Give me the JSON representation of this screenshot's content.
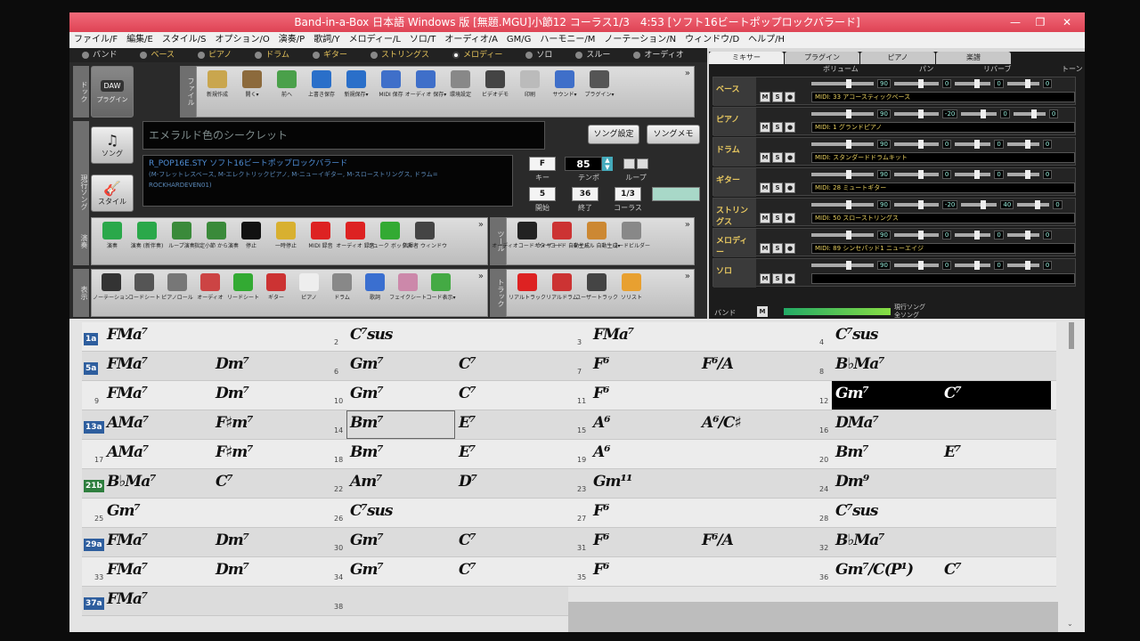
{
  "window": {
    "title": "Band-in-a-Box 日本語 Windows 版 [無題.MGU]小節12 コーラス1/3　4:53 [ソフト16ビートポップロックバラード]",
    "min": "—",
    "max": "❐",
    "close": "✕"
  },
  "menu": [
    "ファイル/F",
    "編集/E",
    "スタイル/S",
    "オプション/O",
    "演奏/P",
    "歌詞/Y",
    "メロディー/L",
    "ソロ/T",
    "オーディオ/A",
    "GM/G",
    "ハーモニー/M",
    "ノーテーション/N",
    "ウィンドウ/D",
    "ヘルプ/H"
  ],
  "tracks": [
    {
      "label": "バンド",
      "color": "normal"
    },
    {
      "label": "ベース",
      "color": "gold"
    },
    {
      "label": "ピアノ",
      "color": "gold"
    },
    {
      "label": "ドラム",
      "color": "gold"
    },
    {
      "label": "ギター",
      "color": "gold"
    },
    {
      "label": "ストリングス",
      "color": "gold"
    },
    {
      "label": "メロディー",
      "color": "gold",
      "active": true
    },
    {
      "label": "ソロ",
      "color": "normal"
    },
    {
      "label": "スルー",
      "color": "normal"
    },
    {
      "label": "オーディオ",
      "color": "normal"
    }
  ],
  "side_labels": {
    "dock": "ドック",
    "file": "ファイル",
    "play": "演奏",
    "view": "表示",
    "tool": "ツール",
    "track": "トラック",
    "current_song": "現行ソング"
  },
  "top_toolbar": [
    {
      "label": "新規作成",
      "icon": "folder-icon"
    },
    {
      "label": "開く▾",
      "icon": "open-icon"
    },
    {
      "label": "前へ",
      "icon": "prev-icon"
    },
    {
      "label": "上書き保存",
      "icon": "save-icon"
    },
    {
      "label": "新規保存▾",
      "icon": "saveas-icon"
    },
    {
      "label": "MIDI 保存",
      "icon": "midi-save-icon"
    },
    {
      "label": "オーディオ 保存▾",
      "icon": "audio-save-icon"
    },
    {
      "label": "環境設定",
      "icon": "prefs-icon"
    },
    {
      "label": "ビデオデモ",
      "icon": "video-icon"
    },
    {
      "label": "印刷",
      "icon": "print-icon"
    },
    {
      "label": "サウンド▾",
      "icon": "sound-icon"
    },
    {
      "label": "プラグイン▾",
      "icon": "plugin-icon"
    }
  ],
  "dock_buttons": {
    "daw": "DAW",
    "plugin": "プラグイン"
  },
  "song_button": "ソング",
  "style_button": "スタイル",
  "song_title": "エメラルド色のシークレット",
  "style_text": "R_POP16E.STY ソフト16ビートポップロックバラード",
  "style_sub1": "(M-フレットレスベース, M-エレクトリックピアノ, M-ニューイギター, M-スローストリングス, ドラム=",
  "style_sub2": "ROCKHARDEVEN01)",
  "song_settings": "ソング設定",
  "song_memo": "ソングメモ",
  "key": {
    "value": "F",
    "label": "キー"
  },
  "tempo": {
    "value": "85",
    "label": "テンポ"
  },
  "loop_label": "ループ",
  "start": {
    "value": "5",
    "label": "開始"
  },
  "end": {
    "value": "36",
    "label": "終了"
  },
  "chorus": {
    "value": "1/3",
    "label": "コーラス"
  },
  "play_toolbar": [
    {
      "label": "演奏",
      "icon": "play-icon"
    },
    {
      "label": "演奏 (新伴奏)",
      "icon": "replay-icon"
    },
    {
      "label": "ループ演奏",
      "icon": "loop-icon"
    },
    {
      "label": "指定小節 から演奏",
      "icon": "from-bar-icon"
    },
    {
      "label": "停止",
      "icon": "stop-icon"
    },
    {
      "label": "一時停止",
      "icon": "pause-icon"
    },
    {
      "label": "MIDI 録音",
      "icon": "record-icon"
    },
    {
      "label": "オーディオ 録音",
      "icon": "audio-record-icon"
    },
    {
      "label": "ジューク ボックス",
      "icon": "jukebox-icon"
    },
    {
      "label": "指揮者 ウィンドウ",
      "icon": "conductor-icon"
    }
  ],
  "tool_toolbar": [
    {
      "label": "オーディオコード ウィザード",
      "icon": "chord-wizard-icon"
    },
    {
      "label": "ギターコード 自動生成",
      "icon": "guitar-chord-icon"
    },
    {
      "label": "タイトル 自動生成▾",
      "icon": "title-icon"
    },
    {
      "label": "コードビルダー",
      "icon": "chord-builder-icon"
    }
  ],
  "view_toolbar": [
    {
      "label": "ノーテーション",
      "icon": "notation-icon"
    },
    {
      "label": "コードシート",
      "icon": "chordsheet-icon"
    },
    {
      "label": "ピアノロール",
      "icon": "pianoroll-icon"
    },
    {
      "label": "オーディオ",
      "icon": "audio-edit-icon"
    },
    {
      "label": "リードシート",
      "icon": "leadsheet-icon"
    },
    {
      "label": "ギター",
      "icon": "guitar-icon"
    },
    {
      "label": "ピアノ",
      "icon": "piano-icon"
    },
    {
      "label": "ドラム",
      "icon": "drum-icon"
    },
    {
      "label": "歌詞",
      "icon": "lyrics-icon"
    },
    {
      "label": "フェイクシート",
      "icon": "fakesheet-icon"
    },
    {
      "label": "コード表示▾",
      "icon": "chord-display-icon"
    }
  ],
  "track_toolbar": [
    {
      "label": "リアルトラック",
      "icon": "realtracks-icon"
    },
    {
      "label": "リアルドラム",
      "icon": "realdrums-icon"
    },
    {
      "label": "ユーザートラック",
      "icon": "usertracks-icon"
    },
    {
      "label": "ソリスト",
      "icon": "soloist-icon"
    }
  ],
  "mixer": {
    "tabs": [
      "ミキサー",
      "プラグイン",
      "ピアノ",
      "楽譜"
    ],
    "headers": [
      "ボリューム",
      "パン",
      "リバーブ",
      "トーン"
    ],
    "channels": [
      {
        "name": "ベース",
        "vol": "90",
        "pan": "0",
        "rev": "0",
        "tone": "0",
        "inst": "MIDI: 33 アコースティックベース"
      },
      {
        "name": "ピアノ",
        "vol": "90",
        "pan": "-20",
        "rev": "0",
        "tone": "0",
        "inst": "MIDI: 1 グランドピアノ"
      },
      {
        "name": "ドラム",
        "vol": "90",
        "pan": "0",
        "rev": "0",
        "tone": "0",
        "inst": "MIDI: スタンダードドラムキット"
      },
      {
        "name": "ギター",
        "vol": "90",
        "pan": "0",
        "rev": "0",
        "tone": "0",
        "inst": "MIDI: 28 ミュートギター"
      },
      {
        "name": "ストリングス",
        "vol": "90",
        "pan": "-20",
        "rev": "40",
        "tone": "0",
        "inst": "MIDI: 50 スローストリングス"
      },
      {
        "name": "メロディー",
        "vol": "90",
        "pan": "0",
        "rev": "0",
        "tone": "0",
        "inst": "MIDI: 89 シンセパッド1 ニューエイジ"
      },
      {
        "name": "ソロ",
        "vol": "90",
        "pan": "0",
        "rev": "0",
        "tone": "0",
        "inst": ""
      }
    ],
    "band": "バンド",
    "current_song": "現行ソング",
    "all_songs": "全ソング"
  },
  "chords": [
    {
      "sect": "1a",
      "bars": [
        [
          "1",
          "FMa⁷",
          ""
        ],
        [
          "2",
          "C⁷sus",
          ""
        ],
        [
          "3",
          "FMa⁷",
          ""
        ],
        [
          "4",
          "C⁷sus",
          ""
        ]
      ]
    },
    {
      "sect": "5a",
      "bars": [
        [
          "5",
          "FMa⁷",
          "Dm⁷"
        ],
        [
          "6",
          "Gm⁷",
          "C⁷"
        ],
        [
          "7",
          "F⁶",
          "F⁶/A"
        ],
        [
          "8",
          "B♭Ma⁷",
          ""
        ]
      ]
    },
    {
      "sect": "",
      "bars": [
        [
          "9",
          "FMa⁷",
          "Dm⁷"
        ],
        [
          "10",
          "Gm⁷",
          "C⁷"
        ],
        [
          "11",
          "F⁶",
          ""
        ],
        [
          "12",
          "Gm⁷",
          "C⁷"
        ]
      ]
    },
    {
      "sect": "13a",
      "bars": [
        [
          "13",
          "AMa⁷",
          "F♯m⁷"
        ],
        [
          "14",
          "Bm⁷",
          "E⁷"
        ],
        [
          "15",
          "A⁶",
          "A⁶/C♯"
        ],
        [
          "16",
          "DMa⁷",
          ""
        ]
      ]
    },
    {
      "sect": "",
      "bars": [
        [
          "17",
          "AMa⁷",
          "F♯m⁷"
        ],
        [
          "18",
          "Bm⁷",
          "E⁷"
        ],
        [
          "19",
          "A⁶",
          ""
        ],
        [
          "20",
          "Bm⁷",
          "E⁷"
        ]
      ]
    },
    {
      "sect": "21b",
      "bars": [
        [
          "21",
          "B♭Ma⁷",
          "C⁷"
        ],
        [
          "22",
          "Am⁷",
          "D⁷"
        ],
        [
          "23",
          "Gm¹¹",
          ""
        ],
        [
          "24",
          "Dm⁹",
          ""
        ]
      ]
    },
    {
      "sect": "",
      "bars": [
        [
          "25",
          "Gm⁷",
          ""
        ],
        [
          "26",
          "C⁷sus",
          ""
        ],
        [
          "27",
          "F⁶",
          ""
        ],
        [
          "28",
          "C⁷sus",
          ""
        ]
      ]
    },
    {
      "sect": "29a",
      "bars": [
        [
          "29",
          "FMa⁷",
          "Dm⁷"
        ],
        [
          "30",
          "Gm⁷",
          "C⁷"
        ],
        [
          "31",
          "F⁶",
          "F⁶/A"
        ],
        [
          "32",
          "B♭Ma⁷",
          ""
        ]
      ]
    },
    {
      "sect": "",
      "bars": [
        [
          "33",
          "FMa⁷",
          "Dm⁷"
        ],
        [
          "34",
          "Gm⁷",
          "C⁷"
        ],
        [
          "35",
          "F⁶",
          ""
        ],
        [
          "36",
          "Gm⁷/C(P¹)",
          "C⁷"
        ]
      ]
    },
    {
      "sect": "37a",
      "bars": [
        [
          "37",
          "FMa⁷",
          ""
        ],
        [
          "38",
          "",
          ""
        ]
      ]
    }
  ],
  "colors": {
    "titlebar": "#e04a5a",
    "section_a": "#2e5e9e",
    "section_b": "#2e7e3e",
    "highlight": "#000000"
  }
}
